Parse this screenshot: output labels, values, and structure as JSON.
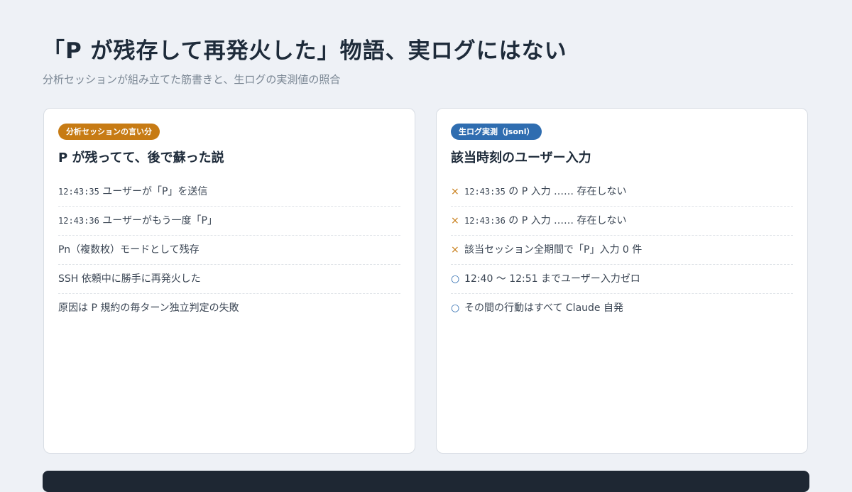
{
  "title": "「P が残存して再発火した」物語、実ログにはない",
  "subtitle": "分析セッションが組み立てた筋書きと、生ログの実測値の照合",
  "left_card": {
    "badge": "分析セッションの言い分",
    "heading": "P が残ってて、後で蘇った説",
    "items": [
      {
        "time": "12:43:35",
        "text": " ユーザーが「P」を送信"
      },
      {
        "time": "12:43:36",
        "text": " ユーザーがもう一度「P」"
      },
      {
        "time": "",
        "text": "Pn（複数枚）モードとして残存"
      },
      {
        "time": "",
        "text": "SSH 依頼中に勝手に再発火した"
      },
      {
        "time": "",
        "text": "原因は P 規約の毎ターン独立判定の失敗"
      }
    ]
  },
  "right_card": {
    "badge": "生ログ実測（jsonl）",
    "heading": "該当時刻のユーザー入力",
    "items": [
      {
        "mark": "×",
        "time": "12:43:35",
        "text": " の P 入力 …… 存在しない"
      },
      {
        "mark": "×",
        "time": "12:43:36",
        "text": " の P 入力 …… 存在しない"
      },
      {
        "mark": "×",
        "time": "",
        "text": "該当セッション全期間で「P」入力 0 件"
      },
      {
        "mark": "○",
        "time": "",
        "text": "12:40 〜 12:51 までユーザー入力ゼロ"
      },
      {
        "mark": "○",
        "time": "",
        "text": "その間の行動はすべて Claude 自発"
      }
    ]
  },
  "colors": {
    "accent_orange": "#c77b14",
    "accent_blue": "#2f6db0",
    "background": "#eef1f6",
    "footer": "#1e2733"
  }
}
